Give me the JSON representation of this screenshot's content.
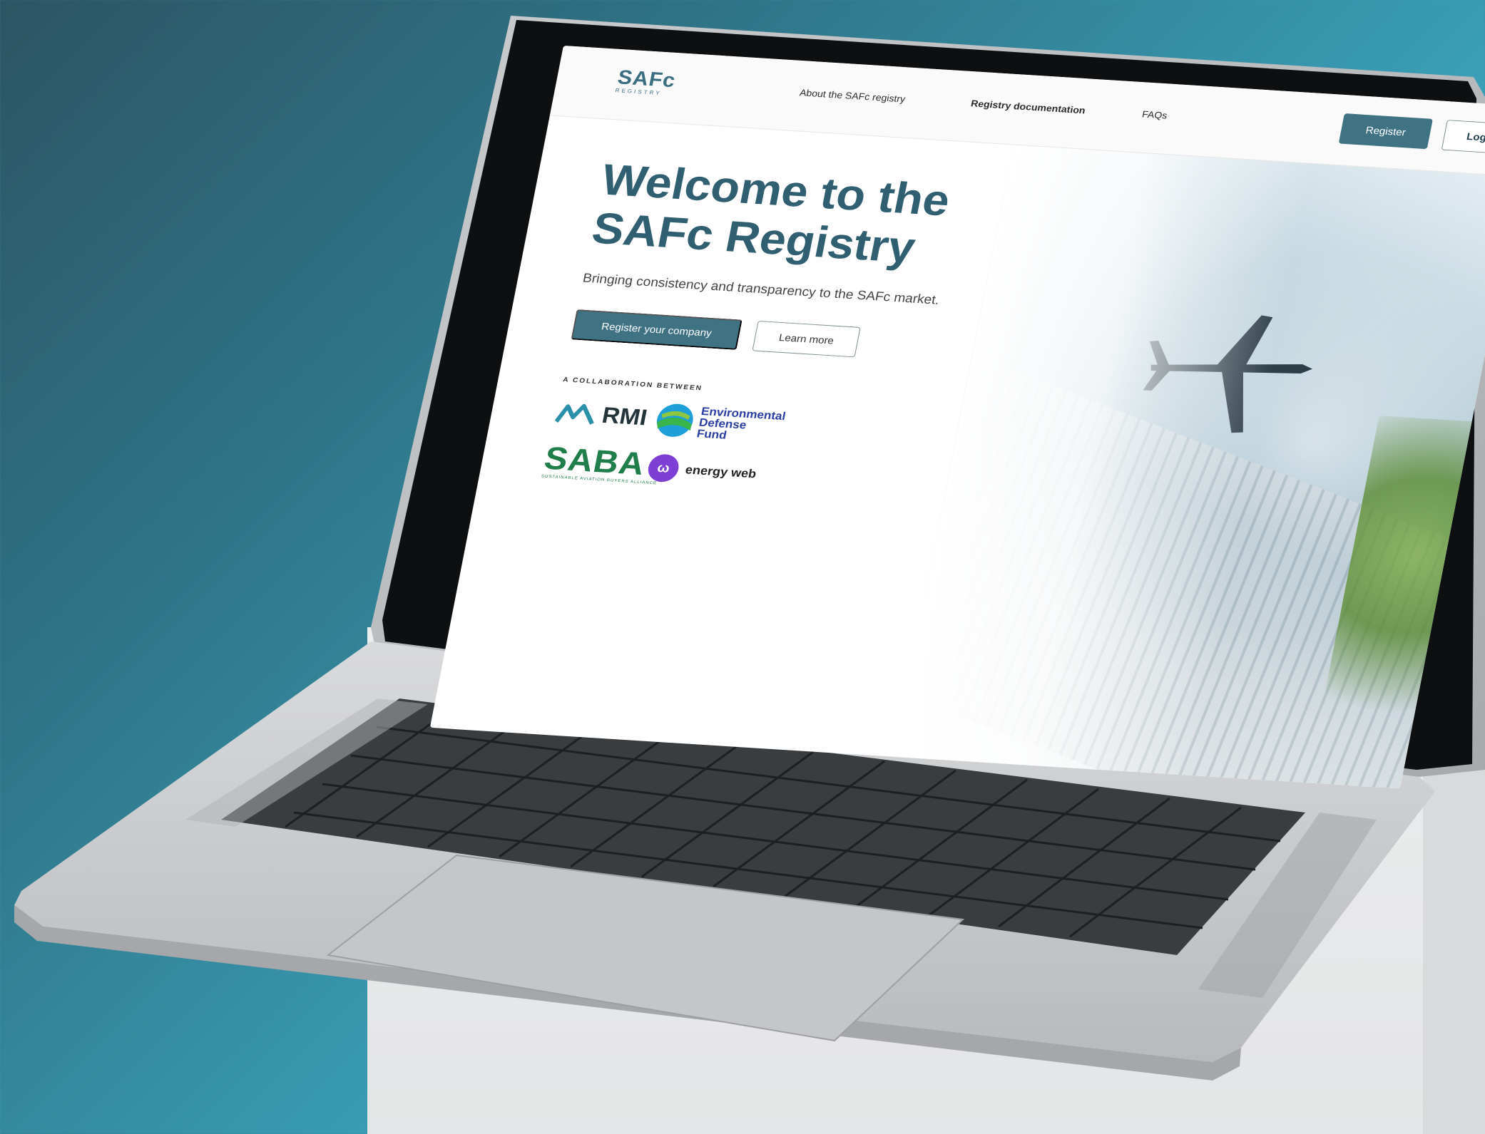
{
  "nav": {
    "logo_main": "SAFc",
    "logo_sub": "REGISTRY",
    "links": [
      "About the SAFc registry",
      "Registry documentation",
      "FAQs"
    ],
    "register_label": "Register",
    "login_label": "Login"
  },
  "hero": {
    "title_line1": "Welcome to the",
    "title_line2": "SAFc Registry",
    "subtitle": "Bringing consistency and transparency to the SAFc market.",
    "cta_primary": "Register your company",
    "cta_secondary": "Learn more"
  },
  "collaboration": {
    "label": "A COLLABORATION BETWEEN",
    "partners": {
      "rmi": "RMI",
      "edf_line1": "Environmental",
      "edf_line2": "Defense",
      "edf_line3": "Fund",
      "saba": "SABA",
      "saba_sub": "SUSTAINABLE AVIATION BUYERS ALLIANCE",
      "ew": "energy web"
    }
  },
  "colors": {
    "brand_teal": "#3f7384",
    "title_teal": "#2f5f70",
    "saba_green": "#1f7e4a",
    "edf_blue": "#2b3ea3",
    "energyweb_purple": "#7e3fd4"
  }
}
